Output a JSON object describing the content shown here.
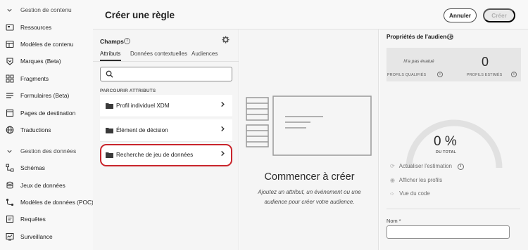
{
  "nav": {
    "section1": "Gestion de contenu",
    "items1": [
      {
        "label": "Ressources",
        "icon": "folder-icon"
      },
      {
        "label": "Modèles de contenu",
        "icon": "template-icon"
      },
      {
        "label": "Marques (Beta)",
        "icon": "brand-icon"
      },
      {
        "label": "Fragments",
        "icon": "fragments-icon"
      },
      {
        "label": "Formulaires (Beta)",
        "icon": "forms-icon"
      },
      {
        "label": "Pages de destination",
        "icon": "landing-page-icon"
      },
      {
        "label": "Traductions",
        "icon": "globe-icon"
      }
    ],
    "section2": "Gestion des données",
    "items2": [
      {
        "label": "Schémas",
        "icon": "schema-icon"
      },
      {
        "label": "Jeux de données",
        "icon": "database-icon"
      },
      {
        "label": "Modèles de données (POC)",
        "icon": "data-model-icon"
      },
      {
        "label": "Requêtes",
        "icon": "queries-icon"
      },
      {
        "label": "Surveillance",
        "icon": "monitoring-icon"
      }
    ]
  },
  "header": {
    "title": "Créer une règle",
    "cancel_label": "Annuler",
    "create_label": "Créer"
  },
  "fields": {
    "title": "Champs",
    "info": "i",
    "tabs": [
      "Attributs",
      "Données contextuelles",
      "Audiences"
    ],
    "search_placeholder": "",
    "browse_heading": "PARCOURIR ATTRIBUTS",
    "attributes": [
      {
        "label": "Profil individuel XDM"
      },
      {
        "label": "Élément de décision"
      },
      {
        "label": "Recherche de jeu de données"
      }
    ]
  },
  "canvas": {
    "title": "Commencer à créer",
    "description": "Ajoutez un attribut, un événement ou une audience pour créer votre audience."
  },
  "props": {
    "title": "Propriétés de l'audience",
    "qualified_value": "N'a pas évalué",
    "qualified_label": "PROFILS QUALIFIÉS",
    "estimated_value": "0",
    "estimated_label": "PROFILS ESTIMÉS",
    "gauge_value": "0 %",
    "gauge_label": "DU TOTAL",
    "gauge_fraction": 0,
    "actions": [
      "Actualiser l'estimation",
      "Afficher les profils",
      "Vue du code"
    ],
    "name_label": "Nom",
    "name_required": "*",
    "name_value": ""
  },
  "colors": {
    "highlight": "#c9252c",
    "panel_bg": "#f5f5f5",
    "card_bg": "#e6e6e6"
  }
}
